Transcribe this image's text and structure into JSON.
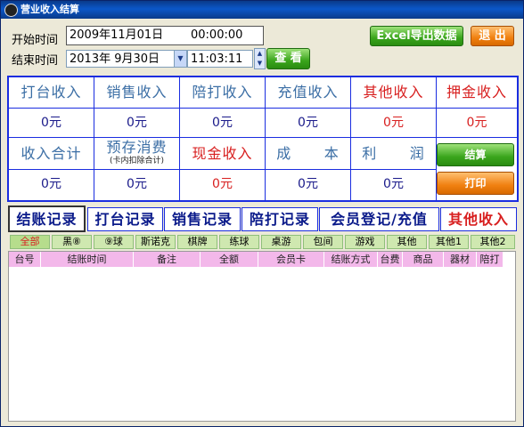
{
  "window": {
    "title": "营业收入结算"
  },
  "filters": {
    "start_label": "开始时间",
    "start_date": "2009年11月01日",
    "start_time": "00:00:00",
    "end_label": "结束时间",
    "end_date": "2013年  9月30日",
    "end_time": "11:03:11",
    "view_button": "查 看"
  },
  "actions": {
    "excel_button": "Excel导出数据",
    "exit_button": "退 出",
    "settle_button": "结算",
    "print_button": "打印"
  },
  "summary_row1": [
    {
      "label": "打台收入",
      "value": "0元"
    },
    {
      "label": "销售收入",
      "value": "0元"
    },
    {
      "label": "陪打收入",
      "value": "0元"
    },
    {
      "label": "充值收入",
      "value": "0元"
    },
    {
      "label": "其他收入",
      "value": "0元"
    },
    {
      "label": "押金收入",
      "value": "0元"
    }
  ],
  "summary_row2": [
    {
      "label": "收入合计",
      "value": "0元"
    },
    {
      "label": "预存消费",
      "sublabel": "(卡内扣除合计)",
      "value": "0元"
    },
    {
      "label": "现金收入",
      "value": "0元"
    },
    {
      "label": "成      本",
      "value": "0元"
    },
    {
      "label": "利      润",
      "value": "0元"
    }
  ],
  "tabs": [
    "结账记录",
    "打台记录",
    "销售记录",
    "陪打记录",
    "会员登记/充值",
    "其他收入"
  ],
  "subtabs": [
    "全部",
    "黑⑧",
    "⑨球",
    "斯诺克",
    "棋牌",
    "练球",
    "桌游",
    "包间",
    "游戏",
    "其他",
    "其他1",
    "其他2"
  ],
  "columns": [
    "台号",
    "结账时间",
    "备注",
    "全额",
    "会员卡",
    "结账方式",
    "台费",
    "商品",
    "器材",
    "陪打"
  ],
  "colors": {
    "accent_blue": "#1a2de0",
    "red": "#d82020",
    "green": "#3aa51c",
    "orange": "#f08010",
    "header_pink": "#f3b8ea"
  }
}
